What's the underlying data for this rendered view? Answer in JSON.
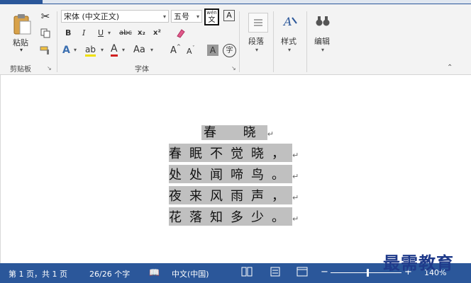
{
  "clipboard": {
    "paste_label": "粘贴",
    "group_label": "剪贴板"
  },
  "font": {
    "font_name": "宋体 (中文正文)",
    "font_size": "五号",
    "phonetic_guide_top": "wén",
    "phonetic_guide_bottom": "文",
    "char_border_label": "A",
    "bold_label": "B",
    "italic_label": "I",
    "underline_label": "U",
    "strike_label": "abc",
    "subscript_label": "x₂",
    "superscript_label": "x²",
    "text_effects_label": "A",
    "highlight_label": "ab",
    "font_color_label": "A",
    "change_case_label": "Aa",
    "grow_label": "A",
    "shrink_label": "A",
    "char_shading_label": "A",
    "enclose_label": "字",
    "group_label": "字体"
  },
  "paragraph": {
    "label": "段落"
  },
  "styles": {
    "label": "样式"
  },
  "editing": {
    "label": "编辑"
  },
  "document": {
    "title_line": "春 晓",
    "lines": [
      "春眠不觉晓，",
      "处处闻啼鸟。",
      "夜来风雨声，",
      "花落知多少。"
    ],
    "para_mark": "↵"
  },
  "status": {
    "page": "第 1 页，共 1 页",
    "words": "26/26 个字",
    "language": "中文(中国)",
    "zoom": "140%"
  },
  "watermark": "最需教育",
  "colors": {
    "accent": "#2b579a",
    "highlight": "#c0c0c0"
  }
}
